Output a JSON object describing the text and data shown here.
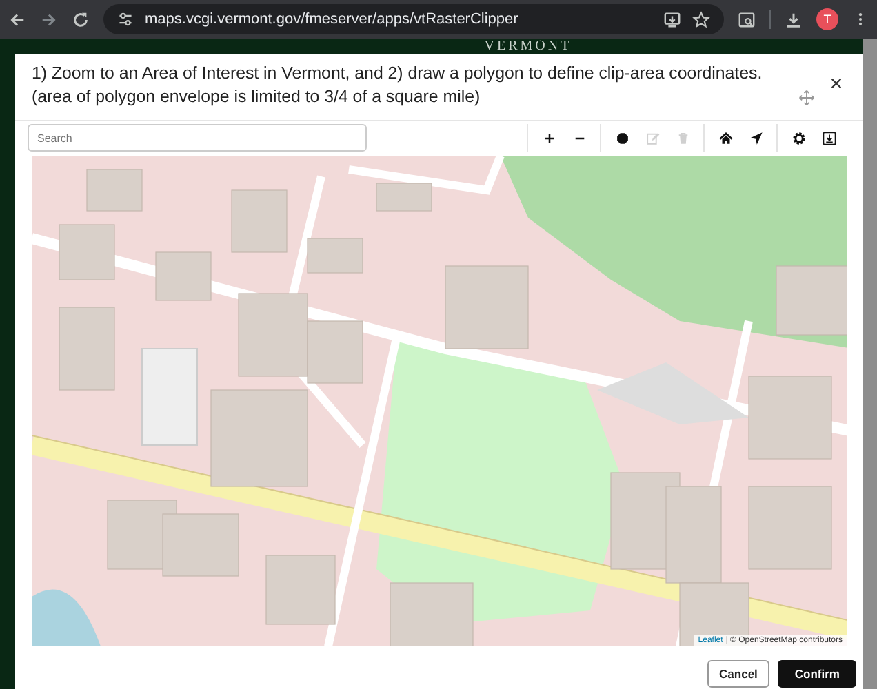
{
  "browser": {
    "url": "maps.vcgi.vermont.gov/fmeserver/apps/vtRasterClipper",
    "profile_initial": "T"
  },
  "page_header": {
    "logo_text": "VERMONT"
  },
  "dialog": {
    "title": "1) Zoom to an Area of Interest in Vermont, and 2) draw a polygon to define clip-area coordinates. (area of polygon envelope is limited to 3/4 of a square mile)",
    "search": {
      "placeholder": "Search"
    },
    "toolbar_groups": [
      [
        {
          "kind": "zoom-in",
          "disabled": false
        },
        {
          "kind": "zoom-out",
          "disabled": false
        }
      ],
      [
        {
          "kind": "polygon",
          "disabled": false
        },
        {
          "kind": "edit",
          "disabled": true
        },
        {
          "kind": "delete",
          "disabled": true
        }
      ],
      [
        {
          "kind": "home",
          "disabled": false
        },
        {
          "kind": "locate",
          "disabled": false
        }
      ],
      [
        {
          "kind": "settings",
          "disabled": false
        },
        {
          "kind": "export",
          "disabled": false
        }
      ]
    ],
    "map": {
      "attribution_link": "Leaflet",
      "attribution_text": "| © OpenStreetMap contributors"
    },
    "buttons": [
      {
        "label": "Cancel",
        "kind": "secondary"
      },
      {
        "label": "Confirm",
        "kind": "primary"
      }
    ]
  }
}
